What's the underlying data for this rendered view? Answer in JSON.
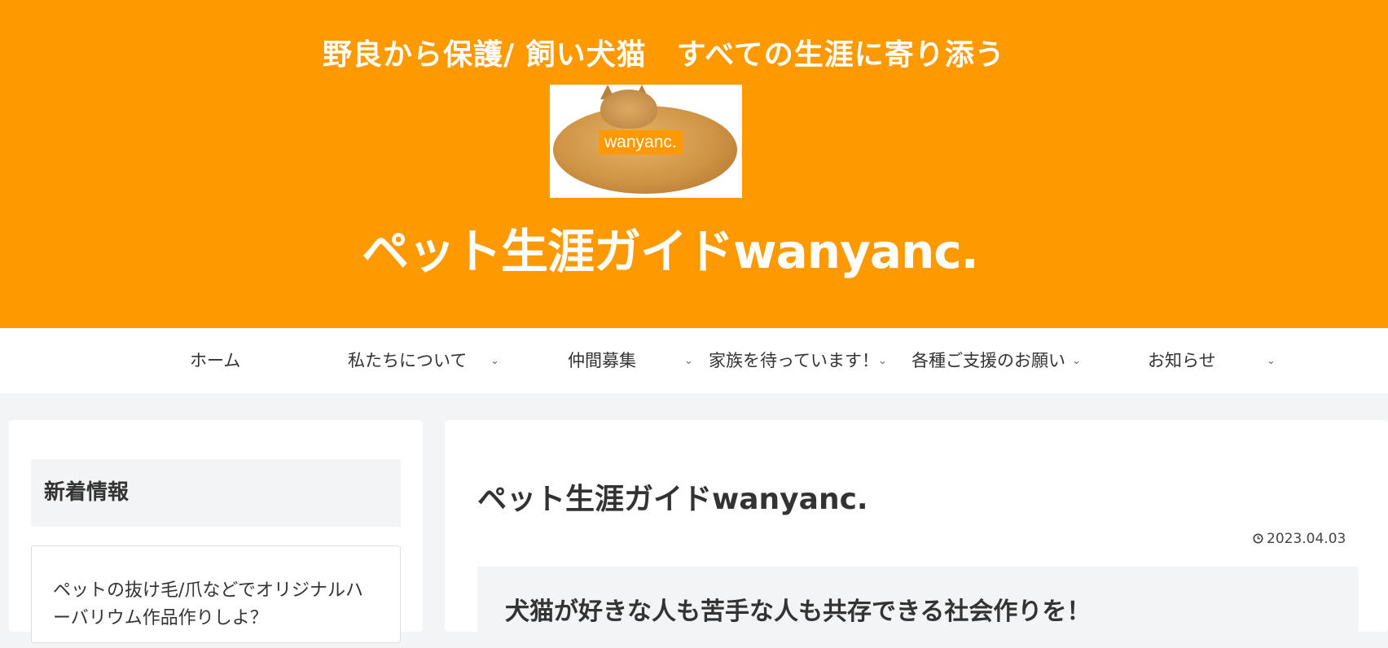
{
  "header": {
    "tagline": "野良から保護/ 飼い犬猫　すべての生涯に寄り添う",
    "logo_text": "wanyanc.",
    "site_title": "ペット生涯ガイドwanyanc.",
    "bg_color": "#ff9900"
  },
  "nav": {
    "items": [
      {
        "label": "ホーム",
        "has_submenu": false
      },
      {
        "label": "私たちについて",
        "has_submenu": true
      },
      {
        "label": "仲間募集",
        "has_submenu": true
      },
      {
        "label": "家族を待っています！",
        "has_submenu": true
      },
      {
        "label": "各種ご支援のお願い",
        "has_submenu": true
      },
      {
        "label": "お知らせ",
        "has_submenu": true
      }
    ],
    "chevron_icon": "chevron-down-icon"
  },
  "sidebar": {
    "widget_title": "新着情報",
    "posts": [
      {
        "title": "ペットの抜け毛/爪などでオリジナルハーバリウム作品作りしよ？"
      }
    ]
  },
  "main": {
    "entry_title": "ペット生涯ガイドwanyanc.",
    "date": "2023.04.03",
    "date_icon": "clock-icon",
    "intro_heading": "犬猫が好きな人も苦手な人も共存できる社会作りを！"
  }
}
